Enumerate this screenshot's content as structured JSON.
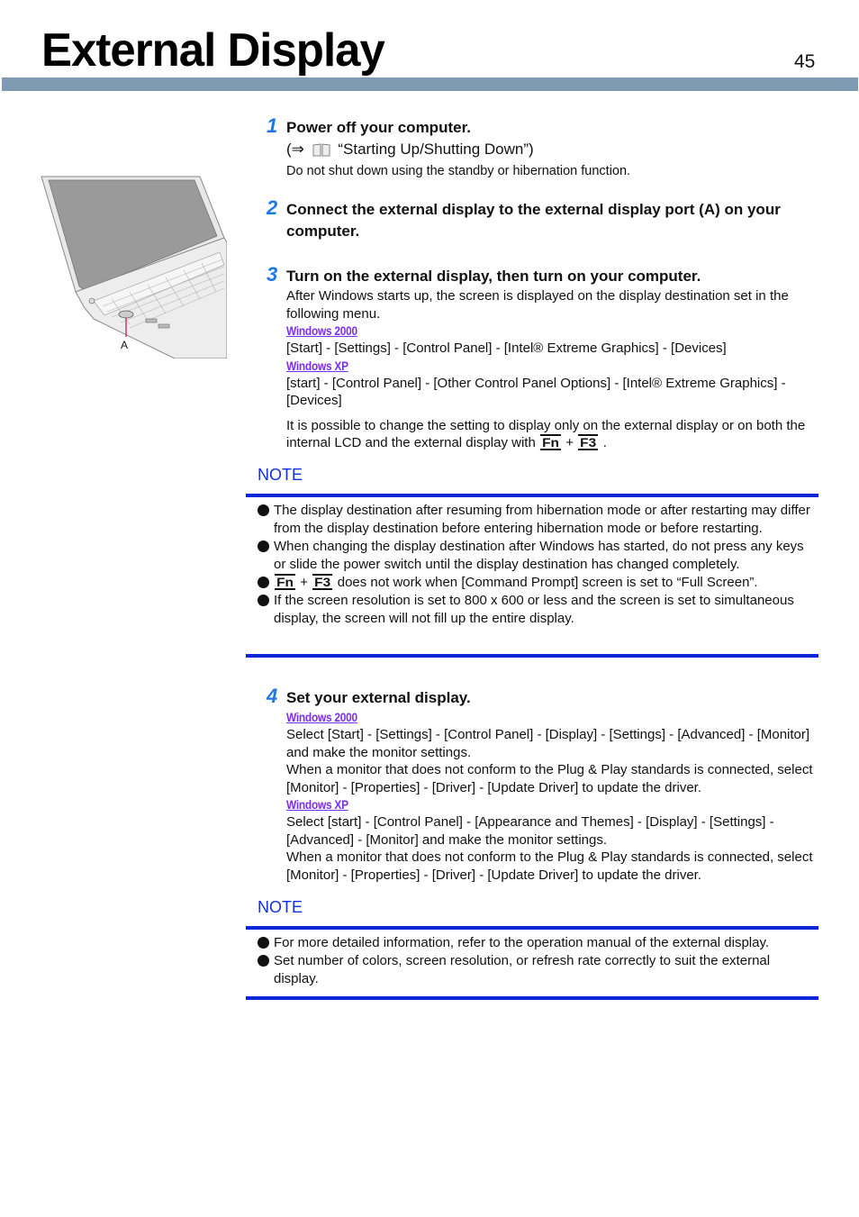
{
  "header": {
    "title": "External Display",
    "page_number": "45"
  },
  "figure": {
    "description": "laptop-external-display-port-illustration",
    "callout_label": "A"
  },
  "steps": [
    {
      "number": "1",
      "title": "Power off your computer.",
      "reference": {
        "arrow": "(⇒",
        "icon": "book-icon",
        "text": "“Starting Up/Shutting Down”)"
      },
      "note": "Do not shut down using the standby or hibernation function."
    },
    {
      "number": "2",
      "title": "Connect the external display to the external display port (A) on your computer."
    },
    {
      "number": "3",
      "title": "Turn on the external display, then turn on your computer.",
      "intro": "After Windows starts up, the screen is displayed on the display destination set in the following menu.",
      "os_paths": [
        {
          "os": "Windows 2000",
          "path": "[Start] - [Settings] - [Control Panel] - [Intel® Extreme Graphics] - [Devices]"
        },
        {
          "os": "Windows XP",
          "path": "[start] - [Control Panel] - [Other Control Panel Options] - [Intel® Extreme Graphics] - [Devices]"
        }
      ],
      "hotkey_text_before": "It is possible to change the setting to display only on the external display or on both the internal LCD and the external display with",
      "hotkey_1": "Fn",
      "hotkey_plus": "+",
      "hotkey_2": "F3",
      "hotkey_text_after": "."
    },
    {
      "number": "4",
      "title": "Set your external display.",
      "os_paths": [
        {
          "os": "Windows 2000",
          "path": "Select [Start] - [Settings] - [Control Panel] - [Display] - [Settings] - [Advanced] - [Monitor] and make the monitor settings.",
          "extra": "When a monitor that does not conform to the Plug & Play standards is connected, select [Monitor] - [Properties] - [Driver] - [Update Driver] to update the driver."
        },
        {
          "os": "Windows XP",
          "path": "Select [start] - [Control Panel] - [Appearance and Themes] - [Display] - [Settings] - [Advanced] - [Monitor] and make the monitor settings.",
          "extra": "When a monitor that does not conform to the Plug & Play standards is connected, select [Monitor] - [Properties] - [Driver] - [Update Driver] to update the driver."
        }
      ]
    }
  ],
  "notes": [
    {
      "label": "NOTE",
      "items": [
        "The display destination after resuming from hibernation mode or after restarting may differ from the display destination before entering hibernation mode or before restarting.",
        "When changing the display destination after Windows has started, do not press any keys or slide the power switch until the display destination has changed completely.",
        {
          "key1": "Fn",
          "plus": "+",
          "key2": "F3",
          "text": "does not work when [Command Prompt] screen is set to “Full Screen”."
        },
        "If the screen resolution is set to 800 x 600 or less and the screen is set to simultaneous display, the screen will not fill up the entire display."
      ]
    },
    {
      "label": "NOTE",
      "items": [
        "For more detailed information, refer to the operation manual of the external display.",
        "Set number of colors, screen resolution, or refresh rate correctly to suit the external display."
      ]
    }
  ],
  "colors": {
    "header_bar": "#7f9bb4",
    "step_number": "#1e78e6",
    "os_label": "#7a2ff0",
    "note_label": "#1432d2",
    "note_bar": "#0a26d6"
  }
}
